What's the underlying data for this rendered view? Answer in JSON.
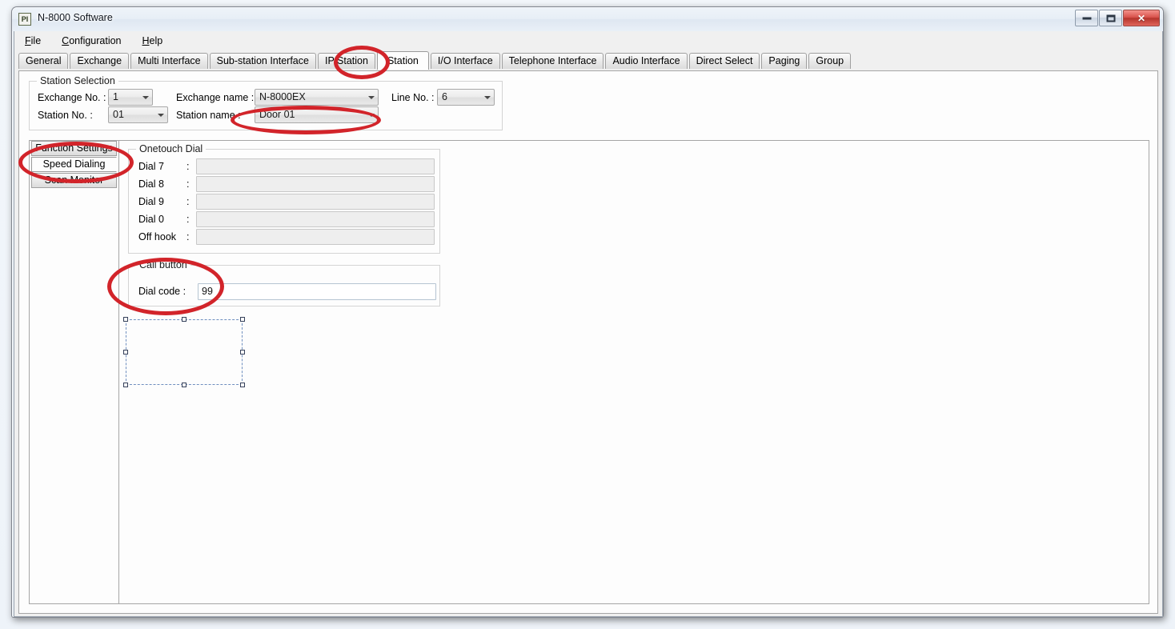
{
  "window": {
    "title": "N-8000 Software",
    "app_icon": "PI",
    "buttons": {
      "minimize": "minimize-icon",
      "maximize": "maximize-icon",
      "close": "✕"
    }
  },
  "menubar": {
    "items": [
      {
        "label": "File",
        "accel": "F"
      },
      {
        "label": "Configuration",
        "accel": "C"
      },
      {
        "label": "Help",
        "accel": "H"
      }
    ]
  },
  "tabs": {
    "active": "Station",
    "items": [
      "General",
      "Exchange",
      "Multi Interface",
      "Sub-station Interface",
      "IP Station",
      "Station",
      "I/O Interface",
      "Telephone Interface",
      "Audio Interface",
      "Direct Select",
      "Paging",
      "Group"
    ]
  },
  "station_selection": {
    "title": "Station Selection",
    "exchange_no": {
      "label": "Exchange No. :",
      "value": "1"
    },
    "exchange_name": {
      "label": "Exchange name :",
      "value": "N-8000EX"
    },
    "line_no": {
      "label": "Line No. :",
      "value": "6"
    },
    "station_no": {
      "label": "Station No.    :",
      "value": "01"
    },
    "station_name": {
      "label": "Station name   :",
      "value": "Door 01"
    }
  },
  "sidebar": {
    "active": "Speed Dialing",
    "items": [
      "Function Settings",
      "Speed Dialing",
      "Scan Monitor"
    ]
  },
  "onetouch_dial": {
    "title": "Onetouch Dial",
    "rows": [
      {
        "label": "Dial 7",
        "colon": ":",
        "value": ""
      },
      {
        "label": "Dial 8",
        "colon": ":",
        "value": ""
      },
      {
        "label": "Dial 9",
        "colon": ":",
        "value": ""
      },
      {
        "label": "Dial 0",
        "colon": ":",
        "value": ""
      },
      {
        "label": "Off hook",
        "colon": ":",
        "value": ""
      }
    ]
  },
  "call_button": {
    "title": "Call button",
    "dial_code": {
      "label": "Dial code :",
      "value": "99"
    }
  },
  "annotations": {
    "color": "#d2242a",
    "ellipses": [
      {
        "name": "annot-station-tab",
        "target": "Station"
      },
      {
        "name": "annot-station-name",
        "target": "Door 01"
      },
      {
        "name": "annot-speed-dialing",
        "target": "Speed Dialing"
      },
      {
        "name": "annot-call-button",
        "target": "Call button / Dial code"
      }
    ]
  }
}
